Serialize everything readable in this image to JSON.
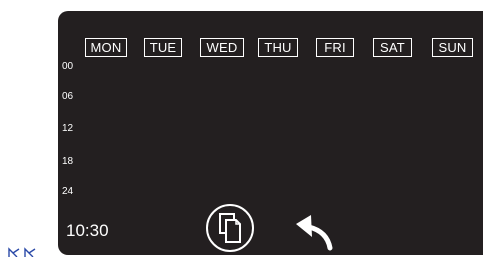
{
  "schedule": {
    "days": [
      "MON",
      "TUE",
      "WED",
      "THU",
      "FRI",
      "SAT",
      "SUN"
    ],
    "hours": [
      "00",
      "06",
      "12",
      "18",
      "24"
    ]
  },
  "status": {
    "time": "10:30"
  },
  "icons": {
    "copy": "copy-icon",
    "back": "back-arrow-icon"
  },
  "colors": {
    "screen_background": "#231f20",
    "foreground": "#ffffff",
    "corner_mark": "#2b4aa8"
  }
}
